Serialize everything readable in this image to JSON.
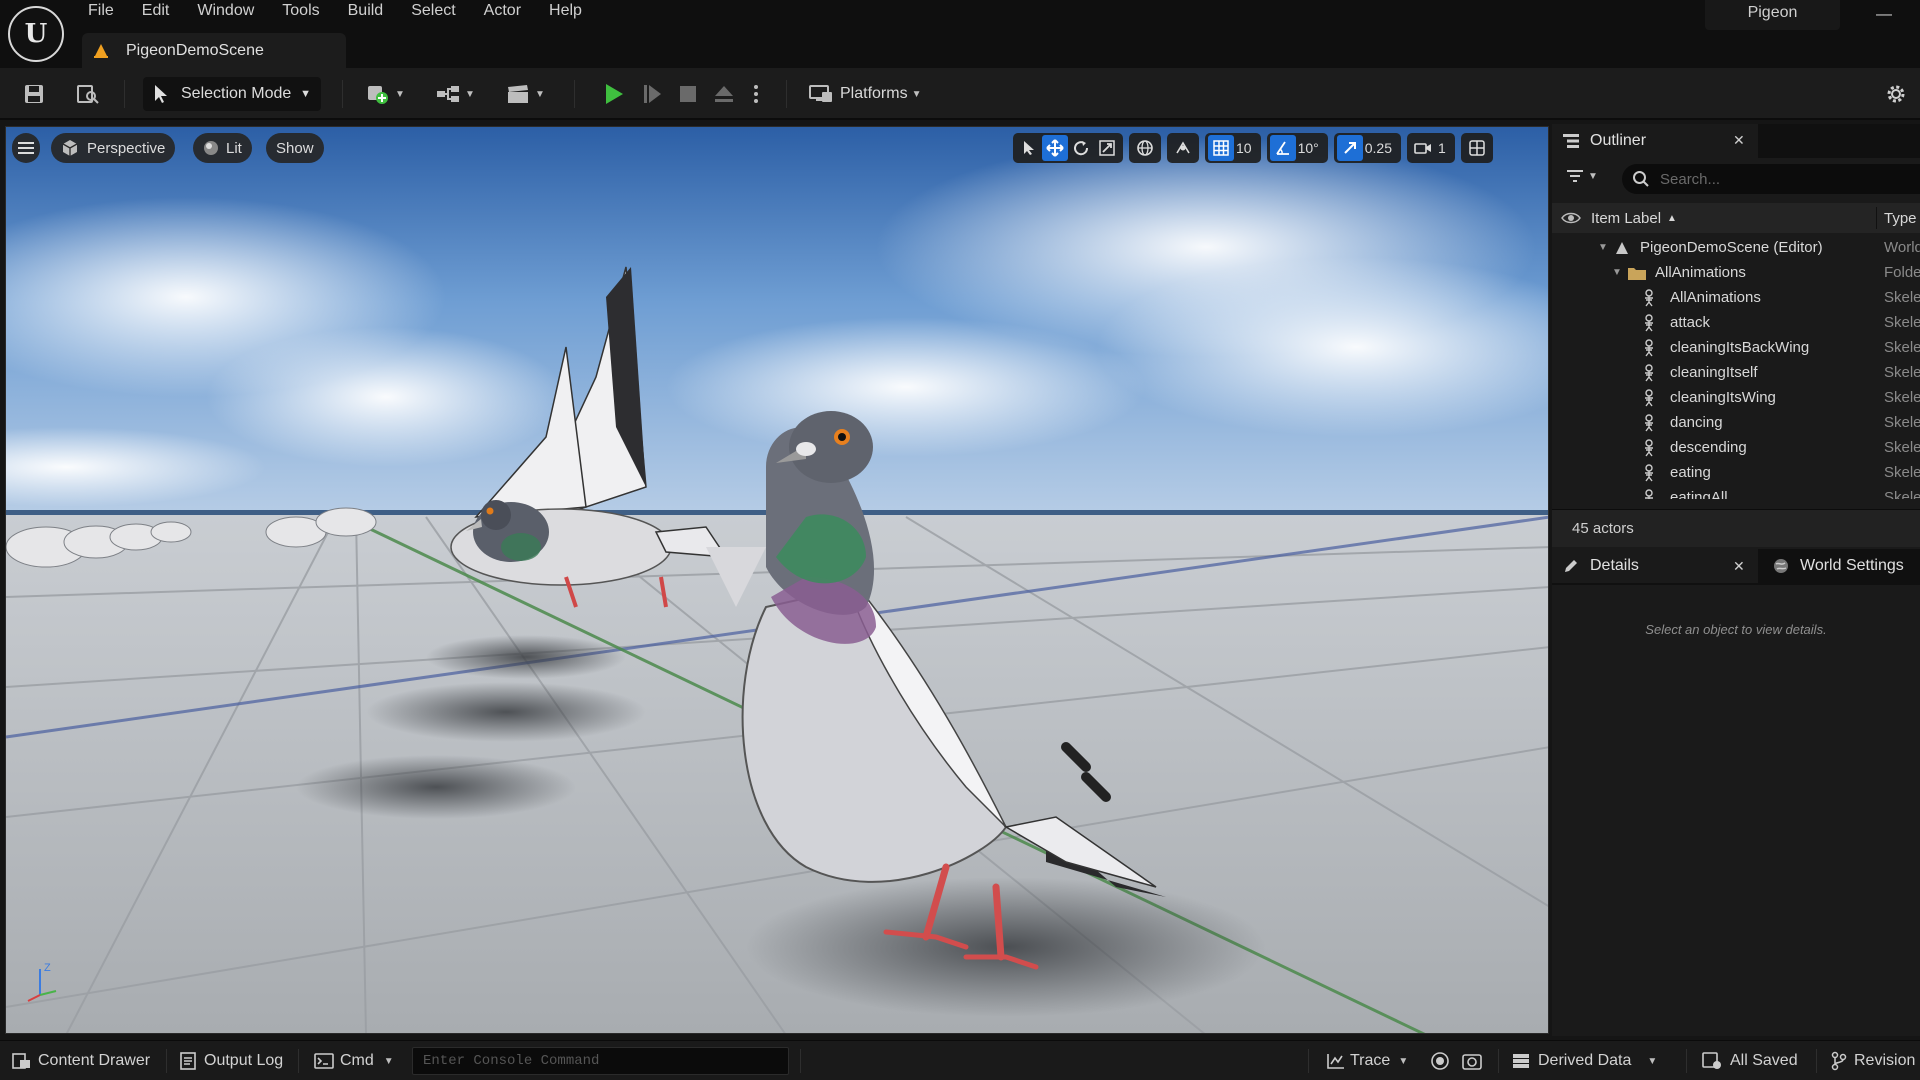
{
  "menu": [
    "File",
    "Edit",
    "Window",
    "Tools",
    "Build",
    "Select",
    "Actor",
    "Help"
  ],
  "document_tab": "PigeonDemoScene",
  "project_name": "Pigeon",
  "toolbar": {
    "selection_mode": "Selection Mode",
    "platforms": "Platforms"
  },
  "viewport": {
    "perspective": "Perspective",
    "lit": "Lit",
    "show": "Show",
    "grid_snap": "10",
    "rotation_snap": "10°",
    "scale_snap": "0.25",
    "camera_speed": "1",
    "gizmo_z": "Z"
  },
  "outliner": {
    "tab_label": "Outliner",
    "search_placeholder": "Search...",
    "col_item_label": "Item Label",
    "col_type": "Type",
    "rows": [
      {
        "label": "PigeonDemoScene (Editor)",
        "type": "World",
        "icon": "level-icon"
      },
      {
        "label": "AllAnimations",
        "type": "Folder",
        "icon": "folder-icon"
      },
      {
        "label": "AllAnimations",
        "type": "Skeletal",
        "icon": "skeletal-mesh-icon"
      },
      {
        "label": "attack",
        "type": "Skeletal",
        "icon": "skeletal-mesh-icon"
      },
      {
        "label": "cleaningItsBackWing",
        "type": "Skeletal",
        "icon": "skeletal-mesh-icon"
      },
      {
        "label": "cleaningItself",
        "type": "Skeletal",
        "icon": "skeletal-mesh-icon"
      },
      {
        "label": "cleaningItsWing",
        "type": "Skeletal",
        "icon": "skeletal-mesh-icon"
      },
      {
        "label": "dancing",
        "type": "Skeletal",
        "icon": "skeletal-mesh-icon"
      },
      {
        "label": "descending",
        "type": "Skeletal",
        "icon": "skeletal-mesh-icon"
      },
      {
        "label": "eating",
        "type": "Skeletal",
        "icon": "skeletal-mesh-icon"
      },
      {
        "label": "eatingAll",
        "type": "Skeletal",
        "icon": "skeletal-mesh-icon"
      }
    ],
    "actor_count": "45 actors"
  },
  "details": {
    "tab_label": "Details",
    "world_settings_label": "World Settings",
    "hint": "Select an object to view details."
  },
  "statusbar": {
    "content_drawer": "Content Drawer",
    "output_log": "Output Log",
    "cmd": "Cmd",
    "console_placeholder": "Enter Console Command",
    "trace": "Trace",
    "derived_data": "Derived Data",
    "all_saved": "All Saved",
    "revision": "Revision"
  },
  "colors": {
    "accent_blue": "#1e6fd6",
    "play_green": "#3fbf3f",
    "warning_orange": "#f0a020"
  }
}
